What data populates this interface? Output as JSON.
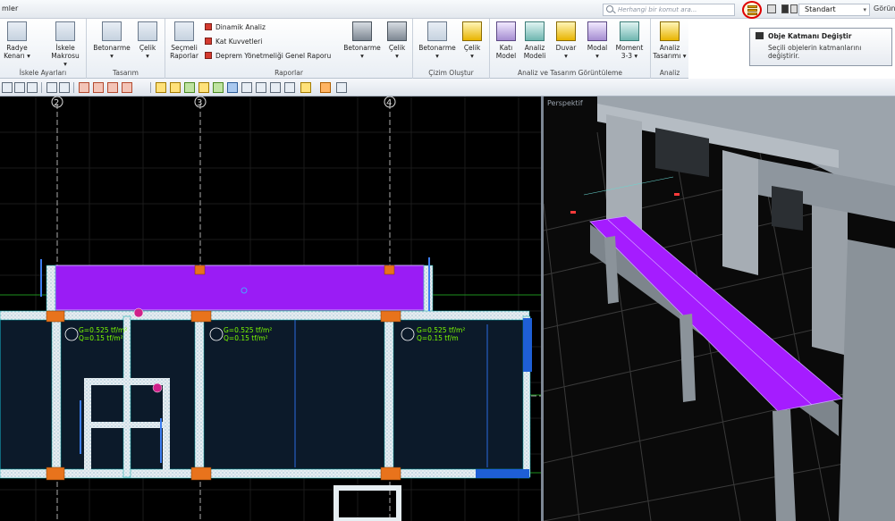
{
  "app": {
    "title_fragment": "mler"
  },
  "search": {
    "placeholder": "Herhangi bir komut ara..."
  },
  "standard_view": {
    "value": "Standart"
  },
  "top_right_text": "Görün",
  "ribbon": {
    "groups": [
      {
        "label": "İskele Ayarları",
        "buttons": [
          "Radye Kenarı",
          "İskele Makrosu"
        ]
      },
      {
        "label": "Tasarım",
        "buttons": [
          "Betonarme",
          "Çelik"
        ]
      },
      {
        "label": "Raporlar",
        "buttons": [
          "Seçmeli Raporlar",
          "Betonarme",
          "Çelik"
        ],
        "links": [
          "Dinamik Analiz",
          "Kat Kuvvetleri",
          "Deprem Yönetmeliği Genel Raporu"
        ]
      },
      {
        "label": "Çizim Oluştur",
        "buttons": [
          "Betonarme",
          "Çelik"
        ]
      },
      {
        "label": "Analiz ve Tasarım Görüntüleme",
        "buttons": [
          "Katı Model",
          "Analiz Modeli",
          "Duvar",
          "Modal",
          "Moment 3-3"
        ]
      },
      {
        "label": "Analiz",
        "buttons": [
          "Analiz Tasarımı"
        ]
      }
    ]
  },
  "tooltip": {
    "title": "Obje Katmanı Değiştir",
    "body": "Seçili objelerin katmanlarını değiştirir."
  },
  "plan": {
    "axis_labels": [
      "2",
      "3",
      "4"
    ],
    "load_labels": [
      {
        "g": "G=0.525 tf/m²",
        "q": "Q=0.15 tf/m²"
      },
      {
        "g": "G=0.525 tf/m²",
        "q": "Q=0.15 tf/m²"
      },
      {
        "g": "G=0.525 tf/m²",
        "q": "Q=0.15 tf/m"
      }
    ]
  },
  "perspective": {
    "label": "Perspektif"
  },
  "colors": {
    "accent_violet": "#9a1cf5",
    "highlight_ring": "#e00000",
    "column_orange": "#e8731c",
    "grid_green": "#1e8f1e"
  }
}
